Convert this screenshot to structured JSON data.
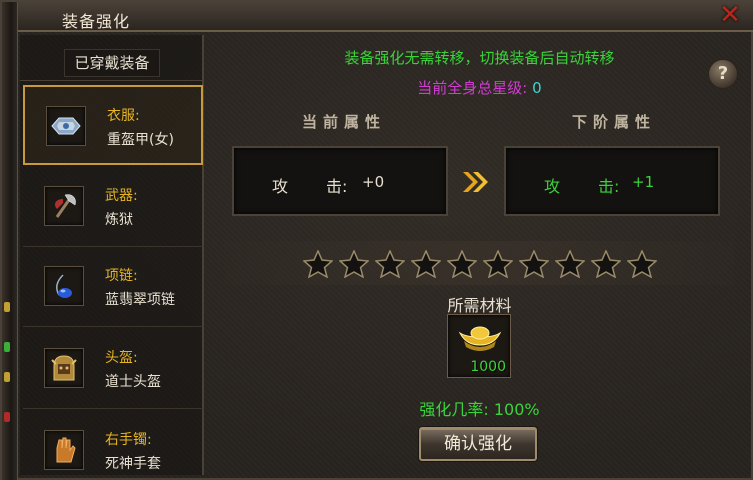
{
  "window": {
    "title": "装备强化",
    "close_icon": "close-x-icon"
  },
  "equip_panel": {
    "header": "已穿戴装备",
    "items": [
      {
        "type": "衣服:",
        "name": "重盔甲(女)",
        "icon": "armor-icon",
        "selected": true
      },
      {
        "type": "武器:",
        "name": "炼狱",
        "icon": "axe-icon",
        "selected": false
      },
      {
        "type": "项链:",
        "name": "蓝翡翠项链",
        "icon": "necklace-icon",
        "selected": false
      },
      {
        "type": "头盔:",
        "name": "道士头盔",
        "icon": "helmet-icon",
        "selected": false
      },
      {
        "type": "右手镯:",
        "name": "死神手套",
        "icon": "gauntlet-icon",
        "selected": false
      }
    ]
  },
  "main": {
    "info": "装备强化无需转移，切换装备后自动转移",
    "star_level_label": "当前全身总星级:",
    "star_level_value": "0",
    "help": "?",
    "current_heading": "当前属性",
    "next_heading": "下阶属性",
    "current_attr": {
      "name": "攻",
      "sep": "击:",
      "value": "+0"
    },
    "next_attr": {
      "name": "攻",
      "sep": "击:",
      "value": "+1"
    },
    "stars_total": 10,
    "stars_filled": 0,
    "materials_label": "所需材料",
    "material": {
      "icon": "gold-ingot-icon",
      "qty": "1000"
    },
    "rate": "强化几率: 100%",
    "confirm": "确认强化"
  },
  "colors": {
    "green": "#3ad43a",
    "magenta": "#d23cd2",
    "cyan": "#3ad4d4",
    "gold": "#e6b422",
    "close_red": "#b8261c"
  }
}
